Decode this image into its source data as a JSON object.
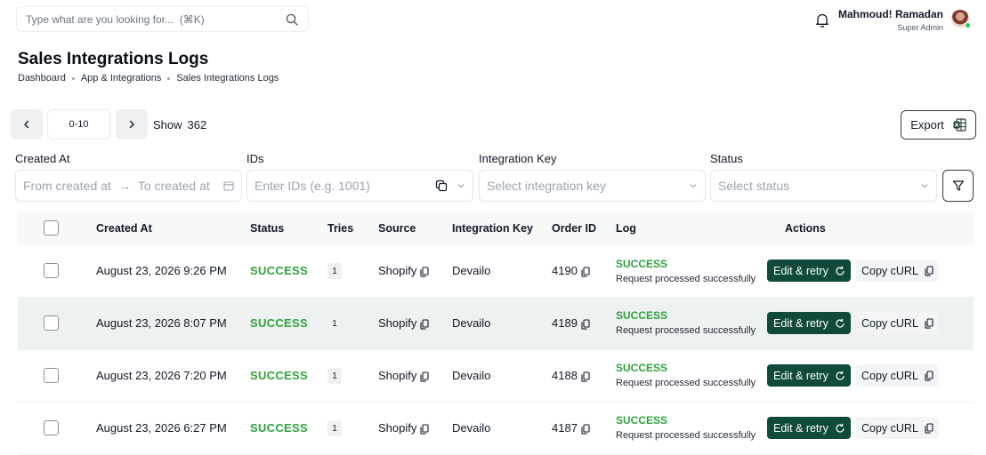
{
  "search": {
    "placeholder": "Type what are you looking for...  (⌘K)"
  },
  "user": {
    "name": "Mahmoud! Ramadan",
    "role": "Super Admin"
  },
  "page": {
    "title": "Sales Integrations Logs",
    "breadcrumbs": [
      "Dashboard",
      "App & Integrations",
      "Sales Integrations Logs"
    ]
  },
  "pagination": {
    "range": "0-10",
    "show_label": "Show",
    "total": "362"
  },
  "export_label": "Export",
  "filters": {
    "created_at": {
      "label": "Created At",
      "from_placeholder": "From created at",
      "arrow": "→",
      "to_placeholder": "To created at"
    },
    "ids": {
      "label": "IDs",
      "placeholder": "Enter IDs (e.g. 1001)"
    },
    "integration_key": {
      "label": "Integration Key",
      "placeholder": "Select integration key"
    },
    "status": {
      "label": "Status",
      "placeholder": "Select status"
    }
  },
  "table": {
    "columns": [
      "Created At",
      "Status",
      "Tries",
      "Source",
      "Integration Key",
      "Order ID",
      "Log",
      "Actions"
    ],
    "rows": [
      {
        "created_at": "August 23, 2026 9:26 PM",
        "status": "SUCCESS",
        "tries": "1",
        "source": "Shopify",
        "integration_key": "Devailo",
        "order_id": "4190",
        "log_status": "SUCCESS",
        "log_message": "Request processed successfully",
        "edit_label": "Edit & retry",
        "copy_label": "Copy cURL"
      },
      {
        "created_at": "August 23, 2026 8:07 PM",
        "status": "SUCCESS",
        "tries": "1",
        "source": "Shopify",
        "integration_key": "Devailo",
        "order_id": "4189",
        "log_status": "SUCCESS",
        "log_message": "Request processed successfully",
        "edit_label": "Edit & retry",
        "copy_label": "Copy cURL"
      },
      {
        "created_at": "August 23, 2026 7:20 PM",
        "status": "SUCCESS",
        "tries": "1",
        "source": "Shopify",
        "integration_key": "Devailo",
        "order_id": "4188",
        "log_status": "SUCCESS",
        "log_message": "Request processed successfully",
        "edit_label": "Edit & retry",
        "copy_label": "Copy cURL"
      },
      {
        "created_at": "August 23, 2026 6:27 PM",
        "status": "SUCCESS",
        "tries": "1",
        "source": "Shopify",
        "integration_key": "Devailo",
        "order_id": "4187",
        "log_status": "SUCCESS",
        "log_message": "Request processed successfully",
        "edit_label": "Edit & retry",
        "copy_label": "Copy cURL"
      }
    ]
  },
  "icons": {
    "search": "search-icon",
    "bell": "bell-icon",
    "prev": "chevron-left-icon",
    "next": "chevron-right-icon",
    "excel": "excel-icon",
    "calendar": "calendar-icon",
    "paste": "paste-icon",
    "chevron_down": "chevron-down-icon",
    "filter": "filter-icon",
    "copy": "copy-icon",
    "retry": "retry-icon"
  },
  "colors": {
    "accent": "#0f4a3c",
    "success": "#2ea33b",
    "row_alt": "#edf1ef",
    "online": "#22c55e"
  }
}
